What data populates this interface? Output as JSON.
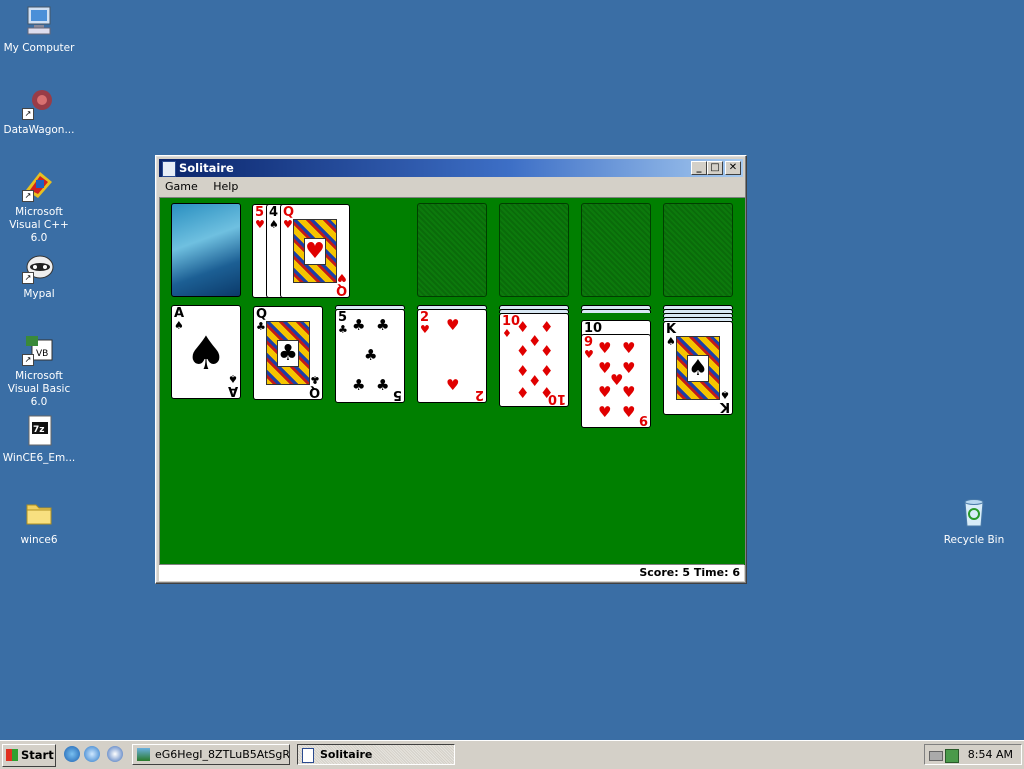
{
  "desktop": {
    "icons": [
      {
        "label": "My Computer",
        "icon": "computer-icon"
      },
      {
        "label": "DataWagon...",
        "icon": "datawagon-icon"
      },
      {
        "label": "Microsoft Visual C++ 6.0",
        "icon": "visual-cpp-icon"
      },
      {
        "label": "Mypal",
        "icon": "mypal-icon"
      },
      {
        "label": "Microsoft Visual Basic 6.0",
        "icon": "visual-basic-icon"
      },
      {
        "label": "WinCE6_Em...",
        "icon": "7z-archive-icon"
      },
      {
        "label": "wince6",
        "icon": "folder-icon"
      },
      {
        "label": "Recycle Bin",
        "icon": "recycle-bin-icon"
      }
    ]
  },
  "window": {
    "title": "Solitaire",
    "minimize": "_",
    "maximize": "□",
    "close": "✕",
    "menu": [
      "Game",
      "Help"
    ],
    "status": "Score: 5 Time: 6"
  },
  "cards": {
    "waste": [
      {
        "rank": "5",
        "suit": "♥",
        "color": "red"
      },
      {
        "rank": "4",
        "suit": "♠",
        "color": "black"
      },
      {
        "rank": "Q",
        "suit": "♥",
        "color": "red"
      }
    ],
    "tableau": [
      {
        "rank": "A",
        "suit": "♠",
        "color": "black"
      },
      {
        "rank": "Q",
        "suit": "♣",
        "color": "black"
      },
      {
        "rank": "5",
        "suit": "♣",
        "color": "black"
      },
      {
        "rank": "2",
        "suit": "♥",
        "color": "red"
      },
      {
        "rank": "10",
        "suit": "♦",
        "color": "red"
      },
      {
        "rank": "9",
        "suit": "♥",
        "color": "red",
        "under": "10"
      },
      {
        "rank": "K",
        "suit": "♠",
        "color": "black"
      }
    ]
  },
  "taskbar": {
    "start": "Start",
    "tasks": [
      {
        "label": "eG6HegI_8ZTLuB5AtSgR...",
        "active": false
      },
      {
        "label": "Solitaire",
        "active": true
      }
    ],
    "clock": "8:54 AM"
  },
  "colors": {
    "desktop": "#3a6ea5",
    "felt": "#007f00",
    "title_active": "#0a246a",
    "red_suit": "#e00000"
  }
}
